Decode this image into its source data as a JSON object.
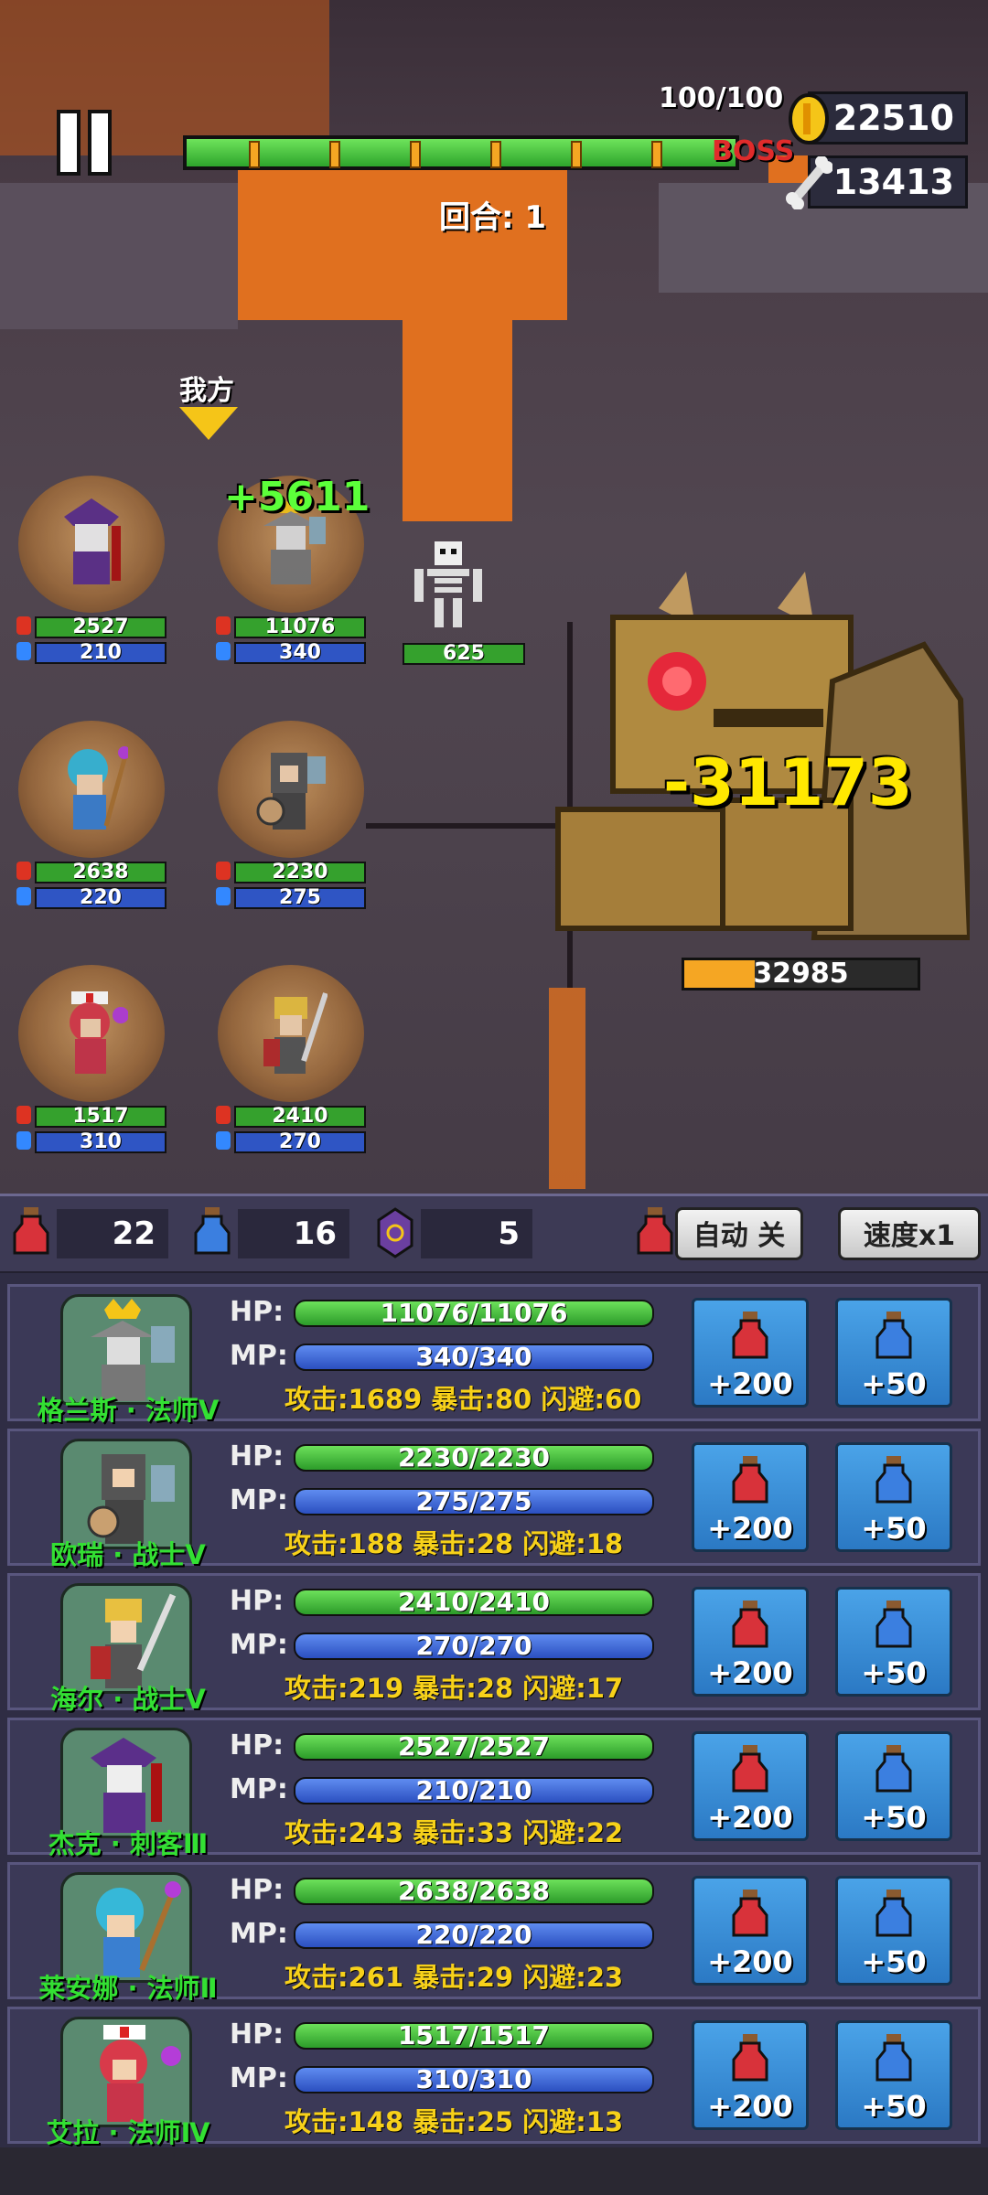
{
  "hud": {
    "stage_progress": "100/100",
    "boss_label": "BOSS",
    "gold": "22510",
    "bones": "13413",
    "round_label": "回合: 1",
    "side_label": "我方"
  },
  "battle": {
    "heal_popup": "+5611",
    "damage_popup": "-31173",
    "boss_hp": "32985",
    "boss_hp_fraction": 0.3,
    "skeleton_hp": "625",
    "heroes": [
      {
        "hp": "2527",
        "mp": "210"
      },
      {
        "hp": "11076",
        "mp": "340"
      },
      {
        "hp": "2638",
        "mp": "220"
      },
      {
        "hp": "2230",
        "mp": "275"
      },
      {
        "hp": "1517",
        "mp": "310"
      },
      {
        "hp": "2410",
        "mp": "270"
      }
    ]
  },
  "toolbar": {
    "hp_potions": "22",
    "mp_potions": "16",
    "scrolls": "5",
    "auto_label": "自动 关",
    "speed_label": "速度x1"
  },
  "labels": {
    "hp": "HP:",
    "mp": "MP:"
  },
  "party": [
    {
      "name": "格兰斯 · 法师Ⅴ",
      "hp": "11076/11076",
      "mp": "340/340",
      "stats": "攻击:1689  暴击:80  闪避:60",
      "hp_btn": "+200",
      "mp_btn": "+50"
    },
    {
      "name": "欧瑞 · 战士Ⅴ",
      "hp": "2230/2230",
      "mp": "275/275",
      "stats": "攻击:188  暴击:28  闪避:18",
      "hp_btn": "+200",
      "mp_btn": "+50"
    },
    {
      "name": "海尔 · 战士Ⅴ",
      "hp": "2410/2410",
      "mp": "270/270",
      "stats": "攻击:219  暴击:28  闪避:17",
      "hp_btn": "+200",
      "mp_btn": "+50"
    },
    {
      "name": "杰克 · 刺客Ⅲ",
      "hp": "2527/2527",
      "mp": "210/210",
      "stats": "攻击:243  暴击:33  闪避:22",
      "hp_btn": "+200",
      "mp_btn": "+50"
    },
    {
      "name": "莱安娜 · 法师Ⅱ",
      "hp": "2638/2638",
      "mp": "220/220",
      "stats": "攻击:261  暴击:29  闪避:23",
      "hp_btn": "+200",
      "mp_btn": "+50"
    },
    {
      "name": "艾拉 · 法师Ⅳ",
      "hp": "1517/1517",
      "mp": "310/310",
      "stats": "攻击:148  暴击:25  闪避:13",
      "hp_btn": "+200",
      "mp_btn": "+50"
    }
  ],
  "colors": {
    "hp_green": "#35a12d",
    "mp_blue": "#2f55c4",
    "stat_yellow": "#f7d11a",
    "name_green": "#33e033",
    "lava": "#e0701f"
  }
}
